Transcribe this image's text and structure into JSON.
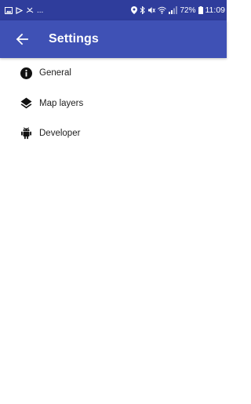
{
  "status_bar": {
    "overflow": "...",
    "battery_percent": "72%",
    "time": "11:09"
  },
  "app_bar": {
    "title": "Settings",
    "background_color": "#3f51b5",
    "status_bar_color": "#2f3d9c"
  },
  "menu": {
    "items": [
      {
        "label": "General",
        "icon": "info-icon"
      },
      {
        "label": "Map layers",
        "icon": "layers-icon"
      },
      {
        "label": "Developer",
        "icon": "android-icon"
      }
    ]
  }
}
